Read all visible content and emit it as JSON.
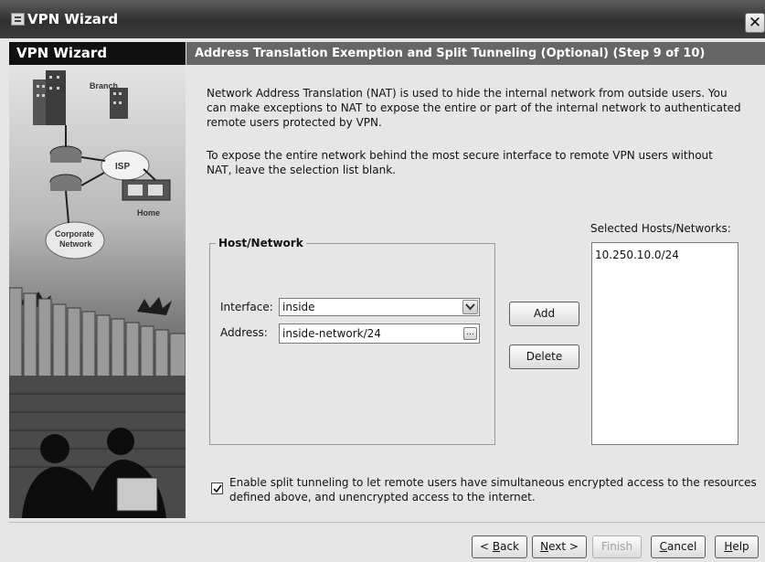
{
  "window": {
    "title": "VPN Wizard",
    "close_glyph": "✕"
  },
  "left_panel": {
    "title": "VPN Wizard",
    "art_labels": {
      "branch": "Branch",
      "isp": "ISP",
      "home": "Home",
      "corporate_line1": "Corporate",
      "corporate_line2": "Network"
    }
  },
  "step": {
    "header": "Address Translation Exemption and Split Tunneling (Optional)  (Step 9 of 10)"
  },
  "description": {
    "para1": "Network Address Translation (NAT) is used to hide the internal network from outside users. You can make exceptions to NAT to expose the entire or part of the internal network to authenticated remote users protected by VPN.",
    "para2": "To expose the entire network behind the most secure interface to remote VPN users without NAT, leave the selection list blank."
  },
  "host_network": {
    "legend": "Host/Network",
    "interface_label": "Interface:",
    "interface_value": "inside",
    "address_label": "Address:",
    "address_value": "inside-network/24",
    "browse_glyph": "..."
  },
  "actions": {
    "add": "Add",
    "delete": "Delete"
  },
  "selected": {
    "label": "Selected Hosts/Networks:",
    "items": [
      "10.250.10.0/24"
    ]
  },
  "split_tunneling": {
    "checked": true,
    "label_line1": "Enable split tunneling to let remote users have simultaneous encrypted access to the resources",
    "label_line2": "defined above, and unencrypted access to the internet."
  },
  "footer": {
    "back_mnemonic": "B",
    "back_rest": "ack",
    "back_prefix": "< ",
    "next_mnemonic": "N",
    "next_rest": "ext >",
    "finish": "Finish",
    "cancel_mnemonic": "C",
    "cancel_rest": "ancel",
    "help_mnemonic": "H",
    "help_rest": "elp"
  },
  "colors": {
    "title_bar": "#3c3c3c",
    "panel_bg": "#e6e6e6",
    "step_header_bg": "#666666",
    "left_title_bg": "#111111"
  },
  "icons": [
    "app-icon",
    "close-icon",
    "dropdown-arrow-icon",
    "browse-icon",
    "checkmark-icon"
  ]
}
